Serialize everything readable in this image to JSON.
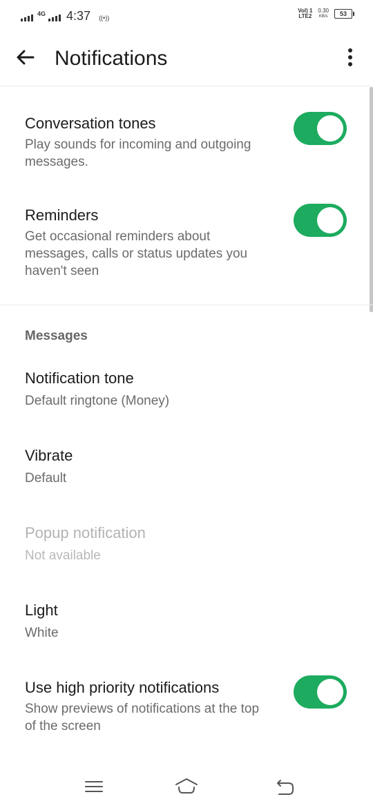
{
  "status_bar": {
    "network": "4G",
    "time": "4:37",
    "hotspot": "((•))",
    "volte": "Vol) 1",
    "lte": "LTE2",
    "speed_value": "0.30",
    "speed_unit": "KB/s",
    "battery": "53"
  },
  "toolbar": {
    "title": "Notifications"
  },
  "settings": {
    "conversation_tones": {
      "title": "Conversation tones",
      "subtitle": "Play sounds for incoming and outgoing messages.",
      "enabled": true
    },
    "reminders": {
      "title": "Reminders",
      "subtitle": "Get occasional reminders about messages, calls or status updates you haven't seen",
      "enabled": true
    }
  },
  "messages_section": {
    "header": "Messages",
    "notification_tone": {
      "title": "Notification tone",
      "value": "Default ringtone (Money)"
    },
    "vibrate": {
      "title": "Vibrate",
      "value": "Default"
    },
    "popup": {
      "title": "Popup notification",
      "value": "Not available"
    },
    "light": {
      "title": "Light",
      "value": "White"
    },
    "high_priority": {
      "title": "Use high priority notifications",
      "subtitle": "Show previews of notifications at the top of the screen",
      "enabled": true
    }
  },
  "colors": {
    "toggle_on": "#1dab5f",
    "text_primary": "#1b1b1b",
    "text_secondary": "#6b6b6b",
    "text_disabled": "#b3b3b3"
  },
  "icons": {
    "back": "arrow-left-icon",
    "more": "more-vert-icon",
    "nav_menu": "menu-lines-icon",
    "nav_home": "home-icon",
    "nav_back": "return-icon"
  }
}
